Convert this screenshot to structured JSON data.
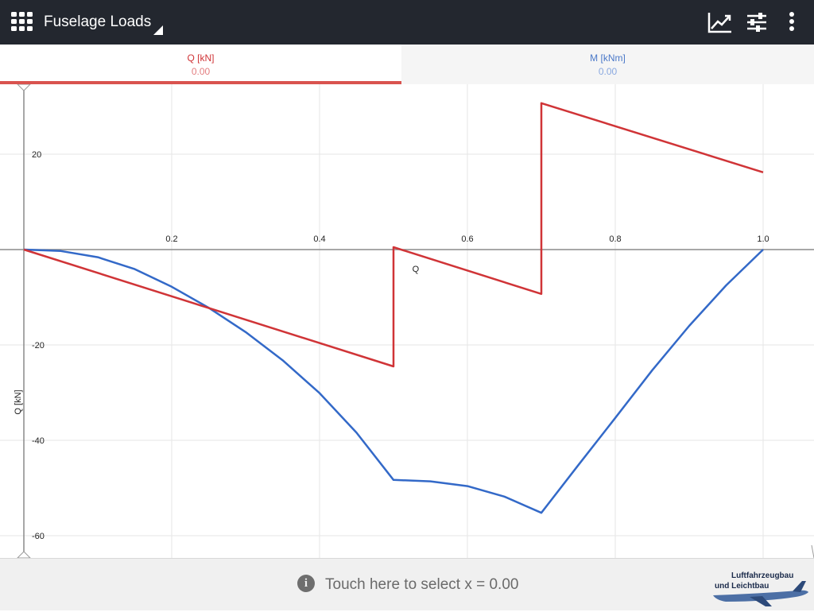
{
  "app": {
    "title": "Fuselage Loads"
  },
  "toolbar": {
    "icons": [
      "apps-grid-icon",
      "dropdown-triangle-icon",
      "line-chart-icon",
      "sliders-icon",
      "more-vert-icon"
    ]
  },
  "tabs": [
    {
      "label": "Q [kN]",
      "value": "0.00",
      "color": "#d03437",
      "selected": true
    },
    {
      "label": "M [kNm]",
      "value": "0.00",
      "color": "#4a78c8",
      "selected": false
    }
  ],
  "chart_data": {
    "type": "line",
    "ylabel": "Q [kN]",
    "xlim": [
      0,
      1.0
    ],
    "ylim": [
      -62,
      34
    ],
    "x_ticks": [
      "0.2",
      "0.4",
      "0.6",
      "0.8",
      "1.0"
    ],
    "y_ticks": [
      "20",
      "-20",
      "-40",
      "-60"
    ],
    "grid": true,
    "series": [
      {
        "name": "Q",
        "color": "#d03437",
        "points": [
          [
            0,
            0
          ],
          [
            0.5,
            -24.5
          ],
          [
            0.5,
            0.5
          ],
          [
            0.7,
            -9.3
          ],
          [
            0.7,
            30.7
          ],
          [
            1.0,
            16.2
          ]
        ]
      },
      {
        "color": "#3369c8",
        "points": [
          [
            0,
            0
          ],
          [
            0.05,
            -0.3
          ],
          [
            0.1,
            -1.6
          ],
          [
            0.15,
            -4.1
          ],
          [
            0.2,
            -7.8
          ],
          [
            0.25,
            -12.2
          ],
          [
            0.3,
            -17.3
          ],
          [
            0.35,
            -23.2
          ],
          [
            0.4,
            -30.1
          ],
          [
            0.45,
            -38.4
          ],
          [
            0.5,
            -48.3
          ],
          [
            0.55,
            -48.6
          ],
          [
            0.6,
            -49.6
          ],
          [
            0.65,
            -51.8
          ],
          [
            0.7,
            -55.2
          ],
          [
            0.75,
            -45.2
          ],
          [
            0.8,
            -35.3
          ],
          [
            0.85,
            -25.3
          ],
          [
            0.9,
            -16.0
          ],
          [
            0.95,
            -7.5
          ],
          [
            1.0,
            0.0
          ]
        ]
      }
    ]
  },
  "footer": {
    "hint": "Touch here to select x = 0.00",
    "logo_line1": "Luftfahrzeugbau",
    "logo_line2": "und Leichtbau"
  }
}
